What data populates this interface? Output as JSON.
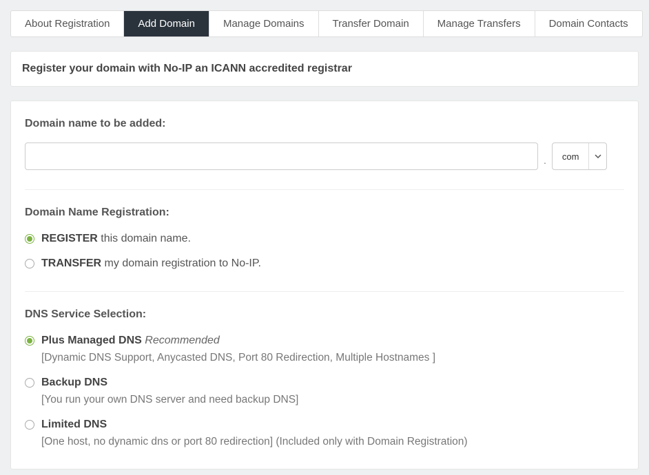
{
  "tabs": [
    {
      "label": "About Registration",
      "active": false
    },
    {
      "label": "Add Domain",
      "active": true
    },
    {
      "label": "Manage Domains",
      "active": false
    },
    {
      "label": "Transfer Domain",
      "active": false
    },
    {
      "label": "Manage Transfers",
      "active": false
    },
    {
      "label": "Domain Contacts",
      "active": false
    }
  ],
  "banner": "Register your domain with No-IP an ICANN accredited registrar",
  "form": {
    "section1_title": "Domain name to be added:",
    "domain_value": "",
    "dot": ".",
    "tld_selected": "com",
    "section2_title": "Domain Name Registration:",
    "reg_options": [
      {
        "bold": "REGISTER",
        "rest": " this domain name.",
        "checked": true
      },
      {
        "bold": "TRANSFER",
        "rest": " my domain registration to No-IP.",
        "checked": false
      }
    ],
    "section3_title": "DNS Service Selection:",
    "dns_options": [
      {
        "bold": "Plus Managed DNS",
        "suffix_italic": " Recommended",
        "desc": "[Dynamic DNS Support, Anycasted DNS, Port 80 Redirection, Multiple Hostnames ]",
        "checked": true
      },
      {
        "bold": "Backup DNS",
        "suffix_italic": "",
        "desc": "[You run your own DNS server and need backup DNS]",
        "checked": false
      },
      {
        "bold": "Limited DNS",
        "suffix_italic": "",
        "desc": "[One host, no dynamic dns or port 80 redirection] (Included only with Domain Registration)",
        "checked": false
      }
    ]
  }
}
